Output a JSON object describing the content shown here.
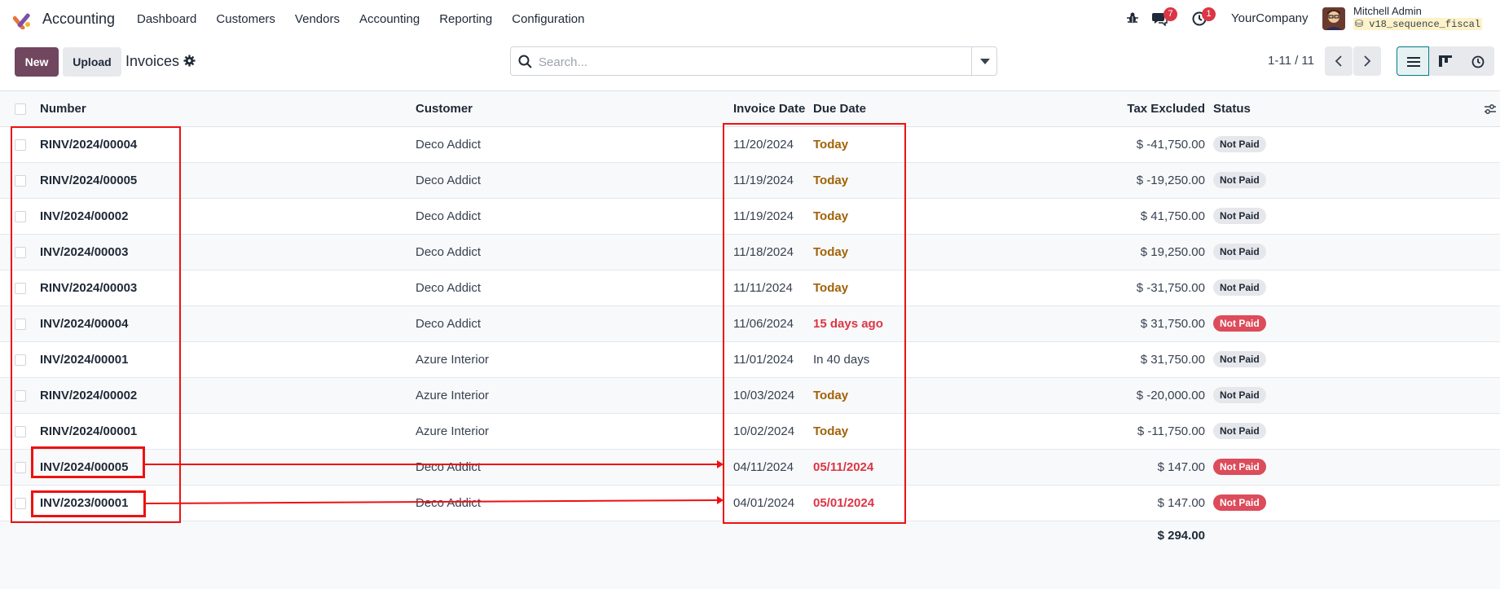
{
  "navbar": {
    "app_name": "Accounting",
    "menu": [
      "Dashboard",
      "Customers",
      "Vendors",
      "Accounting",
      "Reporting",
      "Configuration"
    ],
    "chat_badge": "7",
    "activity_badge": "1",
    "company": "YourCompany",
    "user_name": "Mitchell Admin",
    "db_name": "v18_sequence_fiscal"
  },
  "control": {
    "new_label": "New",
    "upload_label": "Upload",
    "breadcrumb": "Invoices",
    "search_placeholder": "Search...",
    "pager": "1-11 / 11"
  },
  "table": {
    "headers": {
      "number": "Number",
      "customer": "Customer",
      "invoice_date": "Invoice Date",
      "due_date": "Due Date",
      "tax_excluded": "Tax Excluded",
      "status": "Status"
    },
    "rows": [
      {
        "number": "RINV/2024/00004",
        "customer": "Deco Addict",
        "invoice_date": "11/20/2024",
        "due_date": "Today",
        "due_style": "today",
        "tax_excluded": "$ -41,750.00",
        "status": "Not Paid",
        "status_style": "grey"
      },
      {
        "number": "RINV/2024/00005",
        "customer": "Deco Addict",
        "invoice_date": "11/19/2024",
        "due_date": "Today",
        "due_style": "today",
        "tax_excluded": "$ -19,250.00",
        "status": "Not Paid",
        "status_style": "grey"
      },
      {
        "number": "INV/2024/00002",
        "customer": "Deco Addict",
        "invoice_date": "11/19/2024",
        "due_date": "Today",
        "due_style": "today",
        "tax_excluded": "$ 41,750.00",
        "status": "Not Paid",
        "status_style": "grey"
      },
      {
        "number": "INV/2024/00003",
        "customer": "Deco Addict",
        "invoice_date": "11/18/2024",
        "due_date": "Today",
        "due_style": "today",
        "tax_excluded": "$ 19,250.00",
        "status": "Not Paid",
        "status_style": "grey"
      },
      {
        "number": "RINV/2024/00003",
        "customer": "Deco Addict",
        "invoice_date": "11/11/2024",
        "due_date": "Today",
        "due_style": "today",
        "tax_excluded": "$ -31,750.00",
        "status": "Not Paid",
        "status_style": "grey"
      },
      {
        "number": "INV/2024/00004",
        "customer": "Deco Addict",
        "invoice_date": "11/06/2024",
        "due_date": "15 days ago",
        "due_style": "late",
        "tax_excluded": "$ 31,750.00",
        "status": "Not Paid",
        "status_style": "red"
      },
      {
        "number": "INV/2024/00001",
        "customer": "Azure Interior",
        "invoice_date": "11/01/2024",
        "due_date": "In 40 days",
        "due_style": "normal",
        "tax_excluded": "$ 31,750.00",
        "status": "Not Paid",
        "status_style": "grey"
      },
      {
        "number": "RINV/2024/00002",
        "customer": "Azure Interior",
        "invoice_date": "10/03/2024",
        "due_date": "Today",
        "due_style": "today",
        "tax_excluded": "$ -20,000.00",
        "status": "Not Paid",
        "status_style": "grey"
      },
      {
        "number": "RINV/2024/00001",
        "customer": "Azure Interior",
        "invoice_date": "10/02/2024",
        "due_date": "Today",
        "due_style": "today",
        "tax_excluded": "$ -11,750.00",
        "status": "Not Paid",
        "status_style": "grey"
      },
      {
        "number": "INV/2024/00005",
        "customer": "Deco Addict",
        "invoice_date": "04/11/2024",
        "due_date": "05/11/2024",
        "due_style": "late",
        "tax_excluded": "$ 147.00",
        "status": "Not Paid",
        "status_style": "red"
      },
      {
        "number": "INV/2023/00001",
        "customer": "Deco Addict",
        "invoice_date": "04/01/2024",
        "due_date": "05/01/2024",
        "due_style": "late",
        "tax_excluded": "$ 147.00",
        "status": "Not Paid",
        "status_style": "red"
      }
    ],
    "total": "$ 294.00"
  }
}
